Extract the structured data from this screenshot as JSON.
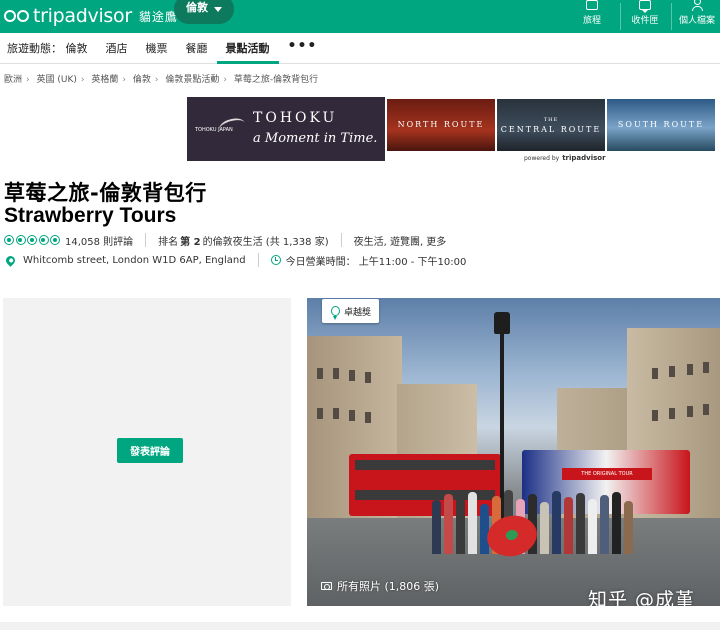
{
  "header": {
    "logo_text": "tripadvisor",
    "logo_sub": "貓途鷹",
    "region_label": "倫敦",
    "actions": [
      {
        "label": "旅程"
      },
      {
        "label": "收件匣"
      },
      {
        "label": "個人檔案"
      }
    ],
    "brand_color": "#00a680"
  },
  "nav": {
    "items": [
      {
        "label": "旅遊動態： 倫敦"
      },
      {
        "label": "酒店"
      },
      {
        "label": "機票"
      },
      {
        "label": "餐廳"
      },
      {
        "label": "景點活動",
        "active": true
      }
    ],
    "more_label": "•••"
  },
  "breadcrumb": [
    "歐洲",
    "英國 (UK)",
    "英格蘭",
    "倫敦",
    "倫敦景點活動",
    "草莓之旅-倫敦背包行"
  ],
  "breadcrumb_sep": "›",
  "ad": {
    "tohoku_title": "TOHOKU",
    "tohoku_tagline": "a Moment in Time.",
    "tohoku_logo": "TOHOKU JAPAN",
    "north_title": "NORTH ROUTE",
    "central_small": "THE",
    "central_title": "CENTRAL ROUTE",
    "south_title": "SOUTH ROUTE",
    "powered_prefix": "powered by",
    "powered_brand": "tripadvisor"
  },
  "listing": {
    "title_zh": "草莓之旅-倫敦背包行",
    "title_en": "Strawberry Tours",
    "rating_bubbles": 5,
    "reviews": "14,058 則評論",
    "rank_prefix": "排名",
    "rank_number": "第 2",
    "rank_suffix": "的倫敦夜生活 (共 1,338 家)",
    "categories": "夜生活, 遊覽團, 更多",
    "address": "Whitcomb street, London W1D 6AP, England",
    "hours": "今日營業時間： 上午11:00 - 下午10:00"
  },
  "review_box": {
    "button_label": "發表評論"
  },
  "photo": {
    "award_label": "卓越獎",
    "all_photos_label": "所有照片 (1,806 張)",
    "bus_banner": "THE ORIGINAL TOUR",
    "watermark": "知乎 @成堇"
  }
}
